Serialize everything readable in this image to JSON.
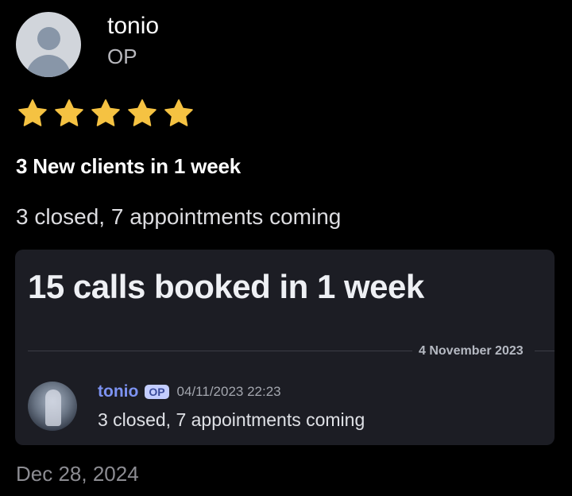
{
  "review": {
    "user": {
      "name": "tonio",
      "role": "OP",
      "avatar_icon": "default-user-avatar-icon"
    },
    "rating": {
      "value": 5,
      "max": 5,
      "star_color": "#f5c242"
    },
    "title": "3 New clients in 1 week",
    "body": "3 closed, 7 appointments coming",
    "date": "Dec 28, 2024"
  },
  "attachment": {
    "title": "15 calls booked in 1 week",
    "divider_date": "4 November 2023",
    "message": {
      "author": "tonio",
      "badge": "OP",
      "timestamp": "04/11/2023 22:23",
      "text": "3 closed, 7 appointments coming",
      "author_color": "#7d93f2"
    }
  }
}
